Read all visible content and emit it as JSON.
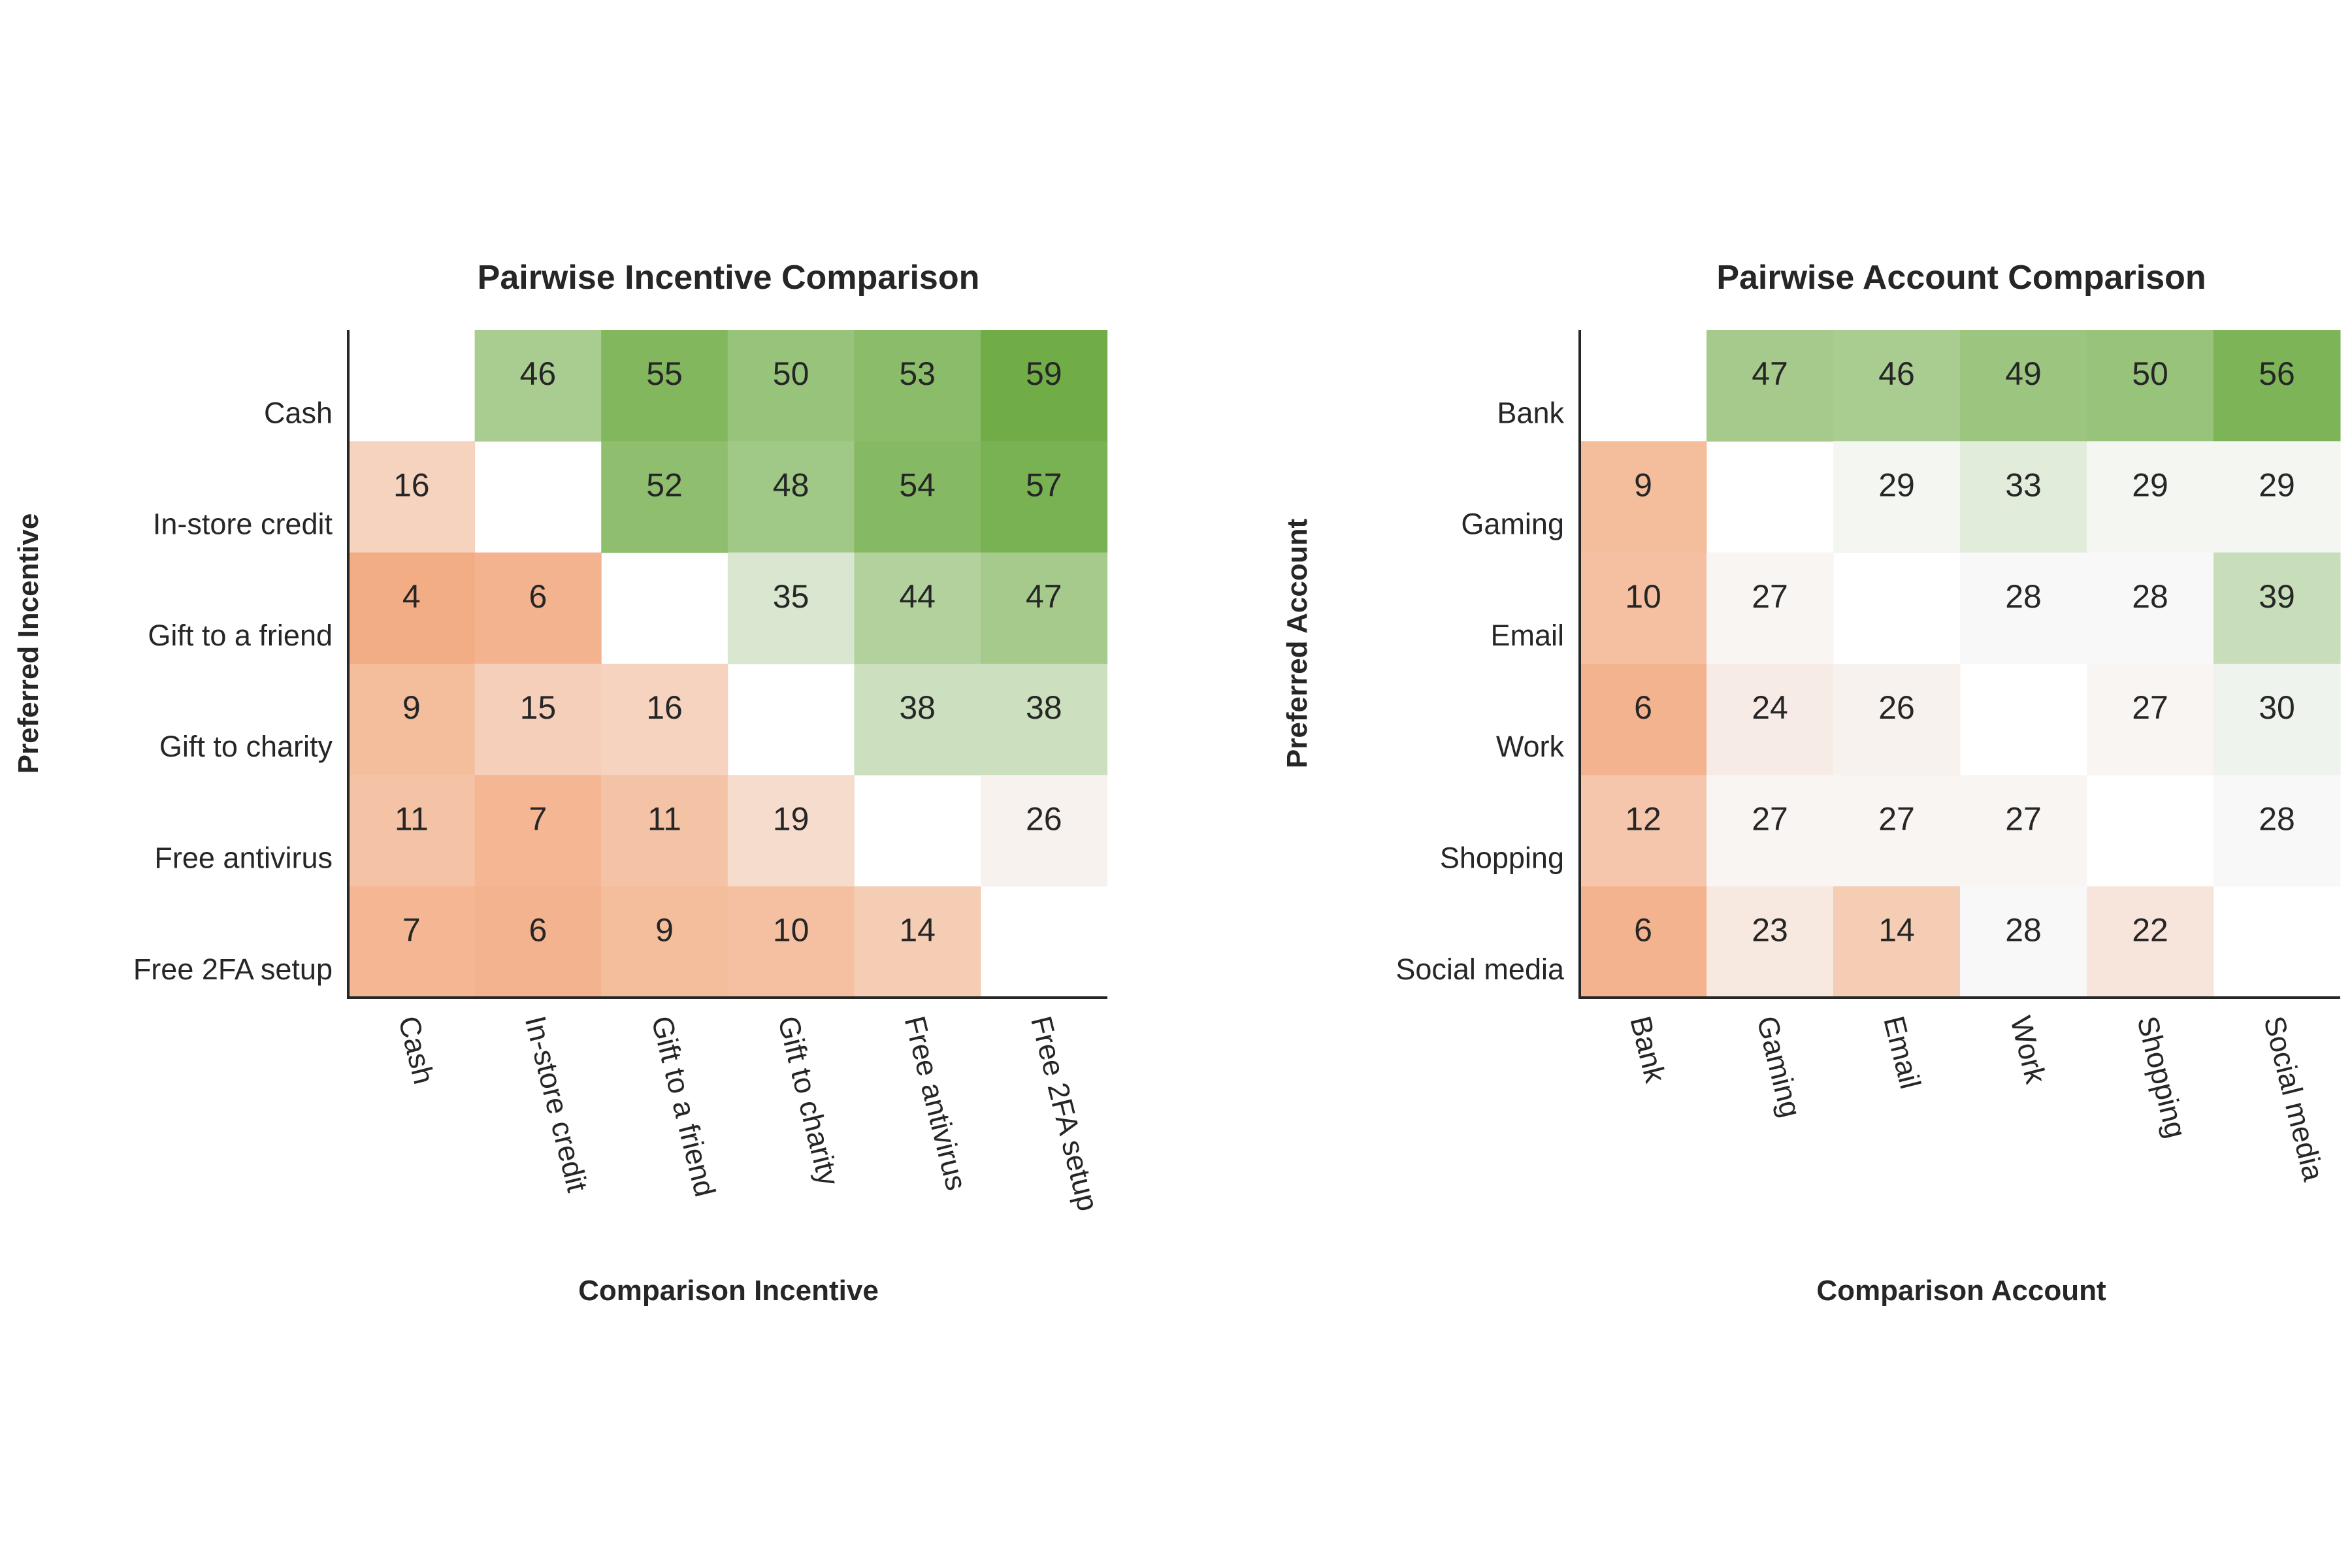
{
  "chart_data": [
    {
      "type": "heatmap",
      "title": "Pairwise Incentive Comparison",
      "xlabel": "Comparison Incentive",
      "ylabel": "Preferred Incentive",
      "rows": [
        "Cash",
        "In-store credit",
        "Gift to a friend",
        "Gift to charity",
        "Free antivirus",
        "Free 2FA setup"
      ],
      "columns": [
        "Cash",
        "In-store credit",
        "Gift to a friend",
        "Gift to charity",
        "Free antivirus",
        "Free 2FA setup"
      ],
      "values": [
        [
          null,
          46,
          55,
          50,
          53,
          59
        ],
        [
          16,
          null,
          52,
          48,
          54,
          57
        ],
        [
          4,
          6,
          null,
          35,
          44,
          47
        ],
        [
          9,
          15,
          16,
          null,
          38,
          38
        ],
        [
          11,
          7,
          11,
          19,
          null,
          26
        ],
        [
          7,
          6,
          9,
          10,
          14,
          null
        ]
      ],
      "color_scale": {
        "low": "#F3AD84",
        "mid": "#F8F8F8",
        "high": "#70AD47",
        "low_value": 4,
        "mid_value": 28,
        "high_value": 59
      }
    },
    {
      "type": "heatmap",
      "title": "Pairwise Account Comparison",
      "xlabel": "Comparison Account",
      "ylabel": "Preferred Account",
      "rows": [
        "Bank",
        "Gaming",
        "Email",
        "Work",
        "Shopping",
        "Social media"
      ],
      "columns": [
        "Bank",
        "Gaming",
        "Email",
        "Work",
        "Shopping",
        "Social media"
      ],
      "values": [
        [
          null,
          47,
          46,
          49,
          50,
          56
        ],
        [
          9,
          null,
          29,
          33,
          29,
          29
        ],
        [
          10,
          27,
          null,
          28,
          28,
          39
        ],
        [
          6,
          24,
          26,
          null,
          27,
          30
        ],
        [
          12,
          27,
          27,
          27,
          null,
          28
        ],
        [
          6,
          23,
          14,
          28,
          22,
          null
        ]
      ],
      "color_scale": {
        "low": "#F3AD84",
        "mid": "#F8F8F8",
        "high": "#70AD47",
        "low_value": 4,
        "mid_value": 28,
        "high_value": 59
      }
    }
  ]
}
